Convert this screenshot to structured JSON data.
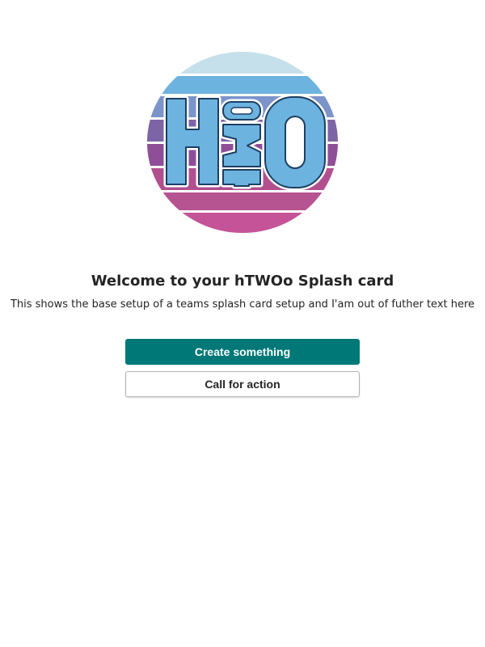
{
  "logo": {
    "name": "htwoo-logo",
    "letters": "hTWOo",
    "colors": {
      "top": "#c5e0ea",
      "light_blue": "#6cb3df",
      "mid_blue": "#7b94c9",
      "purple": "#7d64a6",
      "dark_purple": "#8e4f98",
      "magenta": "#b2508f",
      "pink": "#c45497",
      "letter_fill": "#6cb3df",
      "outline": "#1e3f63"
    }
  },
  "card": {
    "title": "Welcome to your hTWOo Splash card",
    "subtitle": "This shows the base setup of a teams splash card setup and I'am out of futher text here"
  },
  "actions": {
    "primary_label": "Create something",
    "secondary_label": "Call for action"
  },
  "colors": {
    "accent": "#007878",
    "text": "#252424",
    "button_border": "#b4b4b4"
  }
}
